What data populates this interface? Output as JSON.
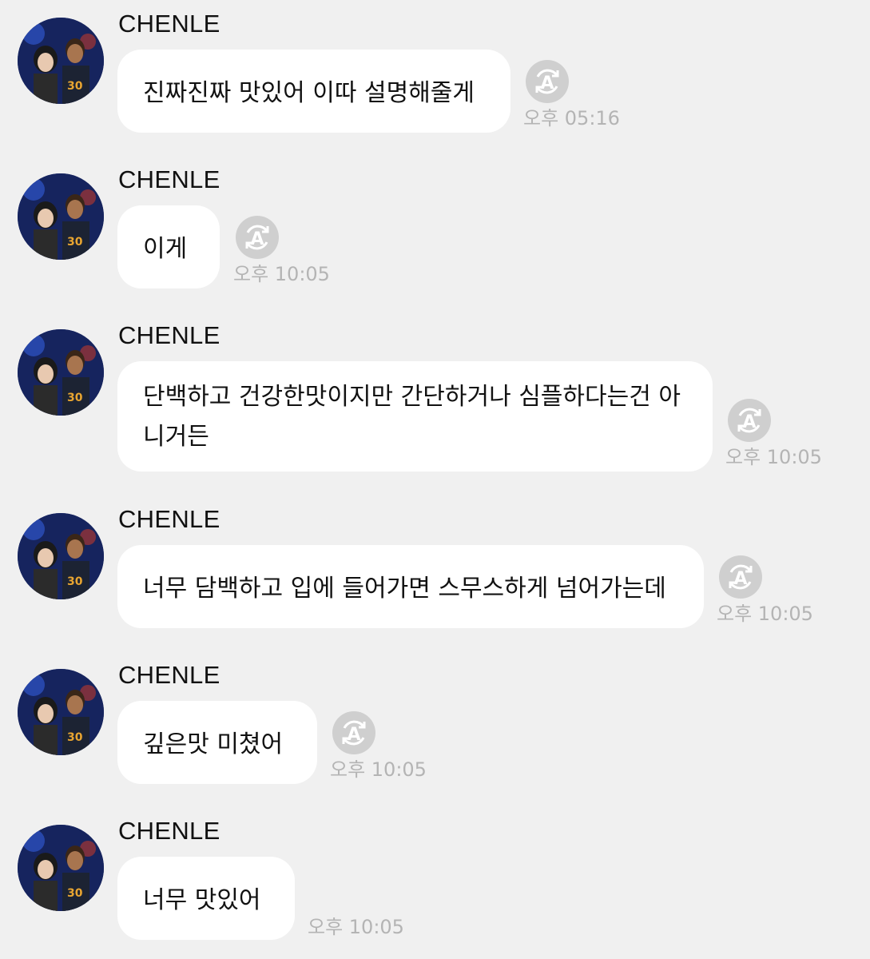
{
  "colors": {
    "background": "#f0f0f0",
    "bubble": "#ffffff",
    "timestamp": "#b4b4b4",
    "read_icon": "#cfcfcf"
  },
  "messages": [
    {
      "sender": "CHENLE",
      "text": "진짜진짜 맛있어 이따 설명해줄게",
      "time": "오후 05:16",
      "icon": "translate-a-icon"
    },
    {
      "sender": "CHENLE",
      "text": "이게",
      "time": "오후 10:05",
      "icon": "translate-a-icon"
    },
    {
      "sender": "CHENLE",
      "text": "단백하고 건강한맛이지만 간단하거나 심플하다는건 아니거든",
      "time": "오후 10:05",
      "icon": "translate-a-icon"
    },
    {
      "sender": "CHENLE",
      "text": "너무 담백하고 입에 들어가면 스무스하게 넘어가는데",
      "time": "오후 10:05",
      "icon": "translate-a-icon"
    },
    {
      "sender": "CHENLE",
      "text": "깊은맛 미쳤어",
      "time": "오후 10:05",
      "icon": "translate-a-icon"
    },
    {
      "sender": "CHENLE",
      "text": "너무 맛있어",
      "time": "오후 10:05"
    }
  ]
}
